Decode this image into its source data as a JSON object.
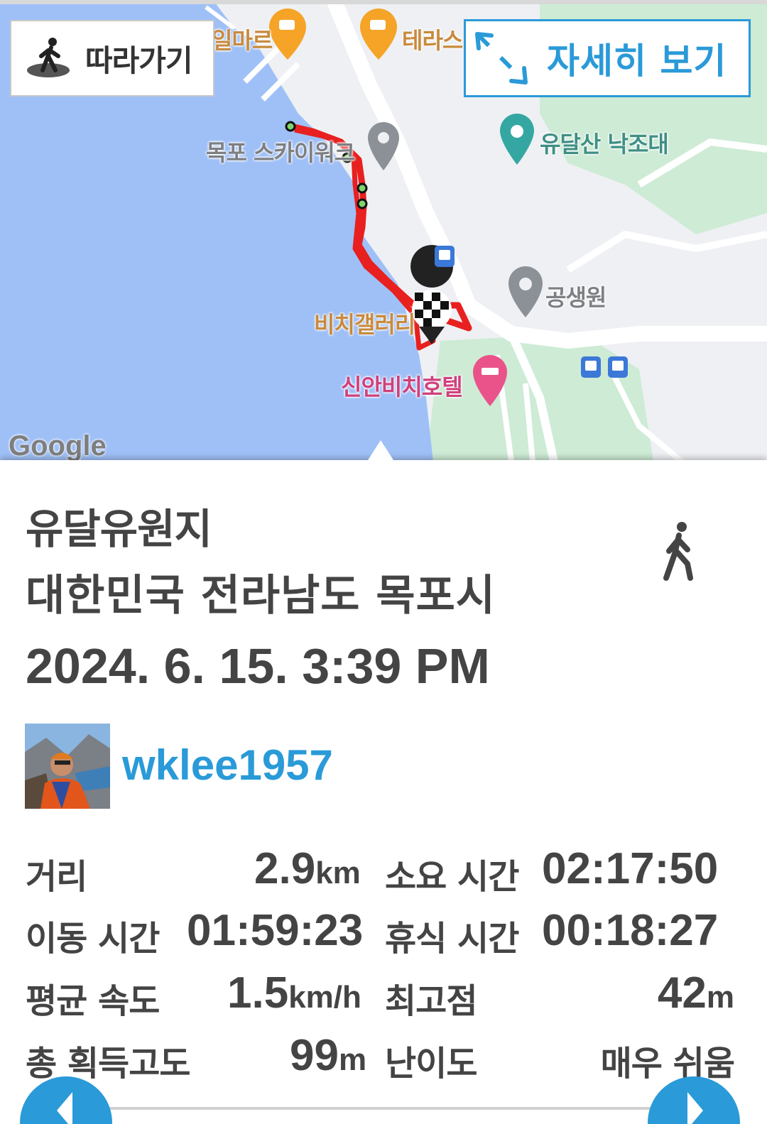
{
  "map": {
    "follow_button": {
      "label": "따라가기",
      "icon": "walker-icon"
    },
    "detail_button": {
      "label": "자세히 보기",
      "icon": "expand-arrows-icon"
    },
    "pois": {
      "cafe1": "일마르",
      "cafe2": "테라스",
      "skywalk": "목포 스카이워크",
      "viewpoint": "유달산 낙조대",
      "park": "공생원",
      "gallery": "비치갤러리",
      "hotel": "신안비치호텔"
    },
    "provider_logo": "Google",
    "colors": {
      "sea": "#9fc0f7",
      "land": "#eef0f3",
      "green": "#cdebd5",
      "track": "#e8201f"
    }
  },
  "track": {
    "title": "유달유원지",
    "address": "대한민국 전라남도 목포시",
    "date": "2024. 6. 15. 3:39 PM",
    "activity_icon": "walking-icon",
    "user": {
      "name": "wklee1957",
      "avatar": "user-avatar-photo"
    }
  },
  "stats": {
    "distance": {
      "label": "거리",
      "value": "2.9",
      "unit": "km"
    },
    "duration": {
      "label": "소요 시간",
      "value": "02:17:50"
    },
    "moving_time": {
      "label": "이동 시간",
      "value": "01:59:23"
    },
    "rest_time": {
      "label": "휴식 시간",
      "value": "00:18:27"
    },
    "avg_speed": {
      "label": "평균 속도",
      "value": "1.5",
      "unit": "km/h"
    },
    "max_elevation": {
      "label": "최고점",
      "value": "42",
      "unit": "m"
    },
    "total_ascent": {
      "label": "총 획득고도",
      "value": "99",
      "unit": "m"
    },
    "difficulty": {
      "label": "난이도",
      "value": "매우 쉬움"
    }
  },
  "accent_color": "#2a9ad8"
}
